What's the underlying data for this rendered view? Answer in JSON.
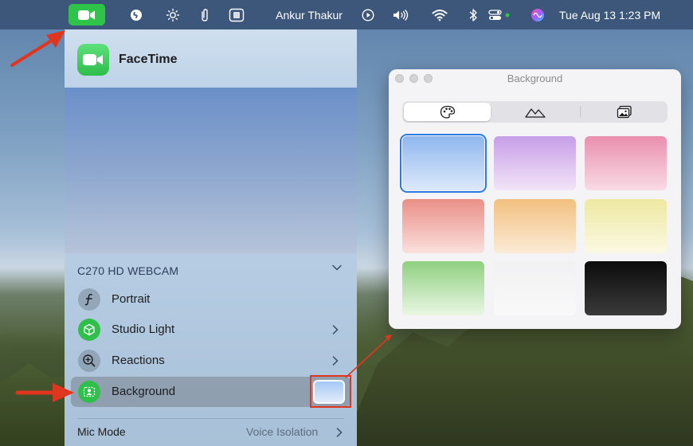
{
  "menubar": {
    "user_name": "Ankur Thakur",
    "clock": "Tue Aug 13  1:23 PM",
    "icons": [
      "facetime-icon",
      "shazam-icon",
      "brightness-icon",
      "paperclip-icon",
      "keyboard-viewer-icon",
      "play-icon",
      "volume-icon",
      "wifi-icon",
      "bluetooth-icon",
      "control-center-icon",
      "siri-icon"
    ]
  },
  "panel": {
    "app_name": "FaceTime",
    "camera_label": "C270 HD WEBCAM",
    "rows": [
      {
        "label": "Portrait",
        "icon": "portrait-f-icon"
      },
      {
        "label": "Studio Light",
        "icon": "cube-icon"
      },
      {
        "label": "Reactions",
        "icon": "reactions-icon"
      },
      {
        "label": "Background",
        "icon": "background-icon"
      }
    ],
    "mic_mode_label": "Mic Mode",
    "mic_mode_value": "Voice Isolation"
  },
  "picker": {
    "title": "Background",
    "tabs": [
      "palette-icon",
      "landscape-icon",
      "photo-icon"
    ],
    "active_tab": 0,
    "swatches": [
      {
        "top": "#8fb7ee",
        "bottom": "#dde9fb",
        "selected": true
      },
      {
        "top": "#c79ee8",
        "bottom": "#f2e4f8",
        "selected": false
      },
      {
        "top": "#ea8fae",
        "bottom": "#f9dbe5",
        "selected": false
      },
      {
        "top": "#ea8f86",
        "bottom": "#fbe0dc",
        "selected": false
      },
      {
        "top": "#f2c07f",
        "bottom": "#fbebd6",
        "selected": false
      },
      {
        "top": "#eee8a1",
        "bottom": "#fbf9e3",
        "selected": false
      },
      {
        "top": "#8fd07f",
        "bottom": "#eaf7e4",
        "selected": false
      },
      {
        "top": "#f1f1f2",
        "bottom": "#f9f9fa",
        "selected": false
      },
      {
        "top": "#0c0c0c",
        "bottom": "#3a3a3a",
        "selected": false
      }
    ]
  },
  "colors": {
    "accent_green": "#2fc34a",
    "annotation_red": "#e0361f",
    "selection_blue": "#2a7be4"
  }
}
